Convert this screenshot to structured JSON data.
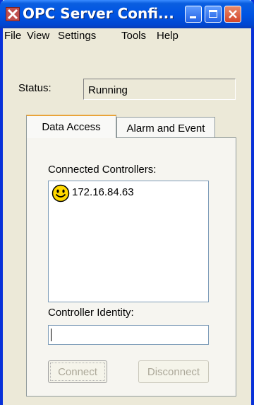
{
  "window": {
    "title": "OPC Server Confi...",
    "icon": "opc-server-app-icon"
  },
  "menu": {
    "items": [
      "File",
      "View",
      "Settings",
      "Tools",
      "Help"
    ]
  },
  "status": {
    "label": "Status:",
    "value": "Running"
  },
  "tabs": [
    {
      "label": "Data Access",
      "selected": true
    },
    {
      "label": "Alarm and Event",
      "selected": false
    }
  ],
  "data_access": {
    "connected_controllers_label": "Connected Controllers:",
    "controllers": [
      {
        "icon": "smiley-icon",
        "address": "172.16.84.63"
      }
    ],
    "controller_identity_label": "Controller Identity:",
    "controller_identity_value": "",
    "connect_label": "Connect",
    "disconnect_label": "Disconnect",
    "connect_enabled": false,
    "disconnect_enabled": false
  },
  "colors": {
    "titlebar": "#0054e3",
    "window_face": "#ece9d8",
    "smiley": "#ffd800"
  }
}
